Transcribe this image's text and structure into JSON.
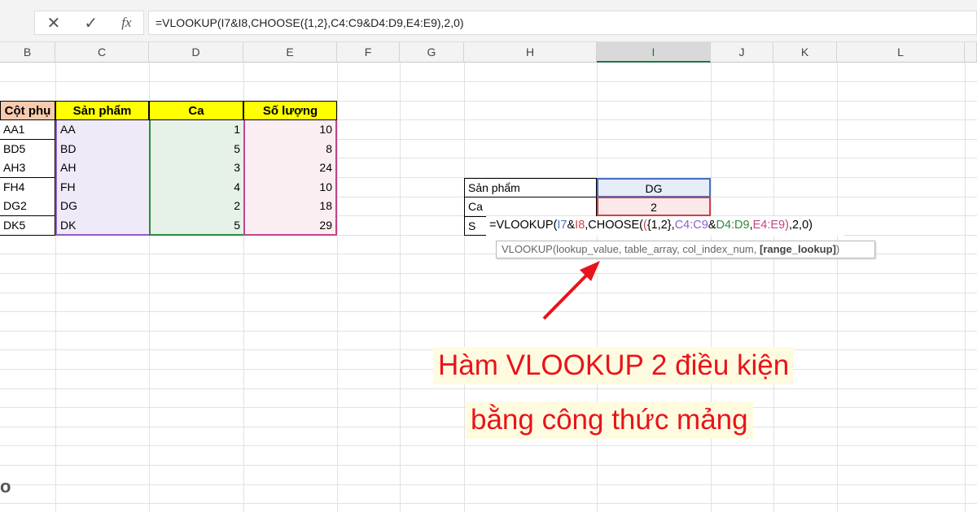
{
  "formula_bar": {
    "cancel": "✕",
    "enter": "✓",
    "fx": "fx",
    "formula": "=VLOOKUP(I7&I8,CHOOSE({1,2},C4:C9&D4:D9,E4:E9),2,0)"
  },
  "columns": [
    "B",
    "C",
    "D",
    "E",
    "F",
    "G",
    "H",
    "I",
    "J",
    "K",
    "L"
  ],
  "table": {
    "headers": [
      "Cột phụ",
      "Sản phẩm",
      "Ca",
      "Số lượng"
    ],
    "rows": [
      [
        "AA1",
        "AA",
        "1",
        "10"
      ],
      [
        "BD5",
        "BD",
        "5",
        "8"
      ],
      [
        "AH3",
        "AH",
        "3",
        "24"
      ],
      [
        "FH4",
        "FH",
        "4",
        "10"
      ],
      [
        "DG2",
        "DG",
        "2",
        "18"
      ],
      [
        "DK5",
        "DK",
        "5",
        "29"
      ]
    ]
  },
  "lookup": {
    "label1": "Sản phẩm",
    "value1": "DG",
    "label2": "Ca",
    "value2": "2",
    "label3": "S",
    "formula_parts": [
      "=VLOOKUP(",
      "I7",
      "&",
      "I8",
      ",CHOOSE(",
      "(",
      "{1,2},",
      "C4:C9",
      "&",
      "D4:D9",
      ",",
      "E4:E9",
      ")",
      ",2,0)"
    ]
  },
  "tooltip": {
    "text": "VLOOKUP(lookup_value, table_array, col_index_num, ",
    "bold": "[range_lookup]",
    "end": ")"
  },
  "caption": {
    "line1": "Hàm VLOOKUP 2 điều kiện",
    "line2": "bằng công thức mảng"
  },
  "watermark": "o"
}
